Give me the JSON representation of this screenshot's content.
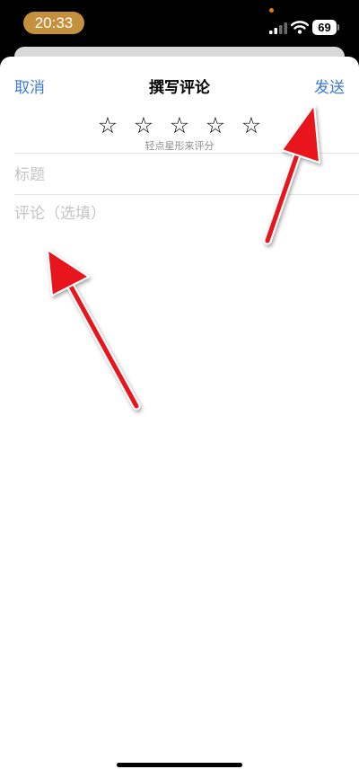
{
  "status_bar": {
    "time": "20:33",
    "battery": "69",
    "icons": [
      "signal-icon",
      "wifi-icon",
      "battery-icon"
    ]
  },
  "header": {
    "cancel_label": "取消",
    "title": "撰写评论",
    "send_label": "发送"
  },
  "rating": {
    "stars": [
      "☆",
      "☆",
      "☆",
      "☆",
      "☆"
    ],
    "hint": "轻点星形来评分"
  },
  "form": {
    "title_placeholder": "标题",
    "comment_placeholder": "评论（选填）"
  },
  "colors": {
    "accent": "#3a7bd5",
    "time_pill": "#c4903e",
    "annotation_arrow": "#e8141c"
  }
}
